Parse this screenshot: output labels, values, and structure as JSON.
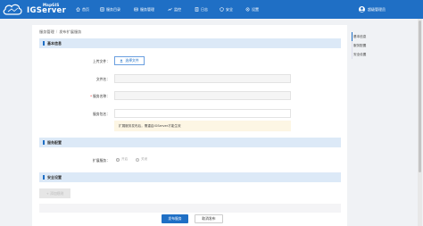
{
  "app": {
    "logo_top": "MapGIS",
    "logo_main": "IGServer"
  },
  "nav": [
    {
      "label": "首页",
      "icon": "home-icon"
    },
    {
      "label": "服务目录",
      "icon": "catalog-icon"
    },
    {
      "label": "服务管理",
      "icon": "service-manage-icon"
    },
    {
      "label": "监控",
      "icon": "monitor-icon"
    },
    {
      "label": "日志",
      "icon": "log-icon"
    },
    {
      "label": "安全",
      "icon": "security-icon"
    },
    {
      "label": "设置",
      "icon": "settings-icon"
    }
  ],
  "user": {
    "name": "超级管理员"
  },
  "breadcrumb": {
    "parent": "服务管理",
    "current": "发布扩展服务"
  },
  "anchors": [
    "基本信息",
    "服务配置",
    "安全设置"
  ],
  "sections": {
    "basic": "基本信息",
    "config": "服务配置",
    "security": "安全设置"
  },
  "form": {
    "upload_label": "上传文件：",
    "upload_button": "选择文件",
    "filename_label": "文件名：",
    "service_name_label": "服务名称：",
    "service_package_label": "服务包名：",
    "tip": "扩展服务发布后，需重启IGServer才能生效",
    "extension_label": "扩展服务：",
    "radio_on": "开启",
    "radio_off": "关闭"
  },
  "buttons": {
    "add_rule": "+ 添加规则",
    "publish": "发布服务",
    "cancel": "取消发布"
  },
  "colors": {
    "primary": "#1f6fc5",
    "section_bg": "#dce9f7",
    "tip_bg": "#fdf6e4"
  }
}
